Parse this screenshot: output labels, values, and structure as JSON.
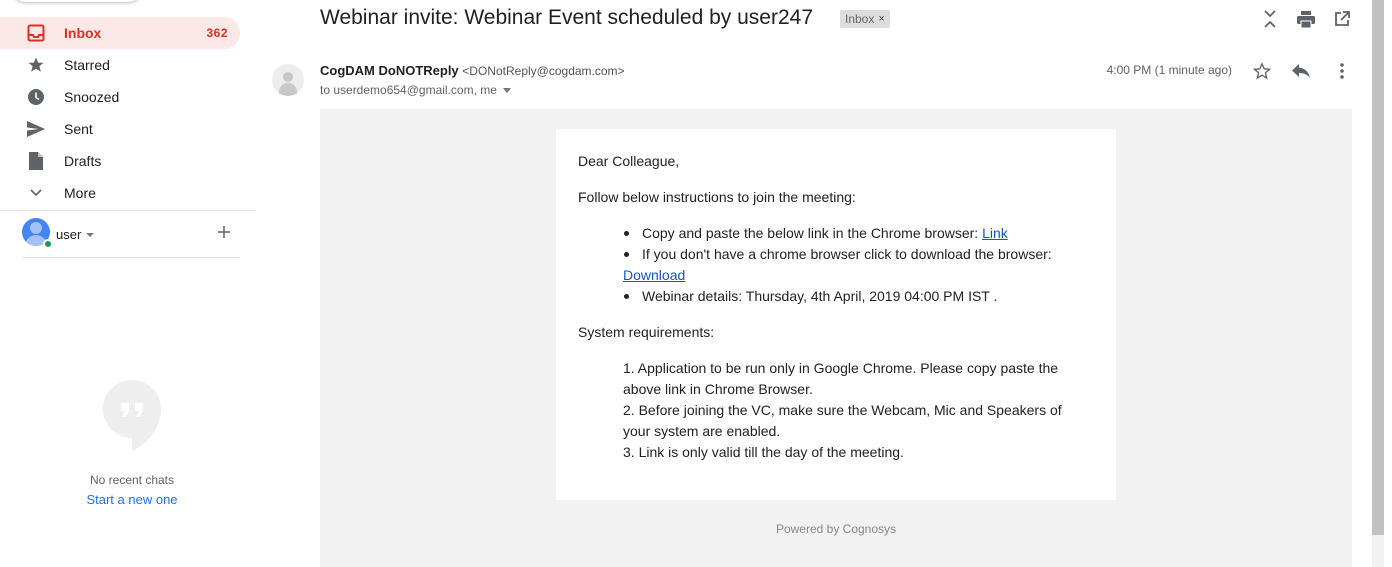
{
  "sidebar": {
    "items": [
      {
        "label": "Inbox",
        "count": "362",
        "icon": "inbox-icon"
      },
      {
        "label": "Starred",
        "icon": "star-icon"
      },
      {
        "label": "Snoozed",
        "icon": "clock-icon"
      },
      {
        "label": "Sent",
        "icon": "send-icon"
      },
      {
        "label": "Drafts",
        "icon": "draft-icon"
      },
      {
        "label": "More",
        "icon": "chevron-down-icon"
      }
    ],
    "user": {
      "name": "user"
    },
    "chat": {
      "empty_text": "No recent chats",
      "start_link": "Start a new one"
    }
  },
  "header": {
    "subject": "Webinar invite: Webinar Event scheduled by user247",
    "label_chip": "Inbox",
    "label_remove": "×"
  },
  "message": {
    "sender_name": "CogDAM DoNOTReply",
    "sender_email": "<DONotReply@cogdam.com>",
    "recipients": "to userdemo654@gmail.com, me",
    "timestamp": "4:00 PM (1 minute ago)"
  },
  "email": {
    "greeting": "Dear Colleague,",
    "instructions_intro": "Follow below instructions to join the meeting:",
    "bullet1_text": "Copy and paste the below link in the Chrome browser: ",
    "bullet1_link": "Link",
    "bullet2_text": "If you don't have a chrome browser click to download the browser:",
    "bullet2_link": "Download",
    "bullet3_text": "Webinar details: Thursday, 4th April, 2019 04:00 PM IST .",
    "requirements_title": "System requirements:",
    "req1_line1": "1. Application to be run only in Google Chrome. Please copy paste the",
    "req1_line2": "above link in Chrome Browser.",
    "req2_line1": "2. Before joining the VC, make sure the Webcam, Mic and Speakers of",
    "req2_line2": "your system are enabled.",
    "req3": "3. Link is only valid till the day of the meeting.",
    "powered_by": "Powered by Cognosys"
  },
  "colors": {
    "accent_red": "#d93025",
    "active_bg": "#fce8e6",
    "link_blue": "#1155cc"
  }
}
